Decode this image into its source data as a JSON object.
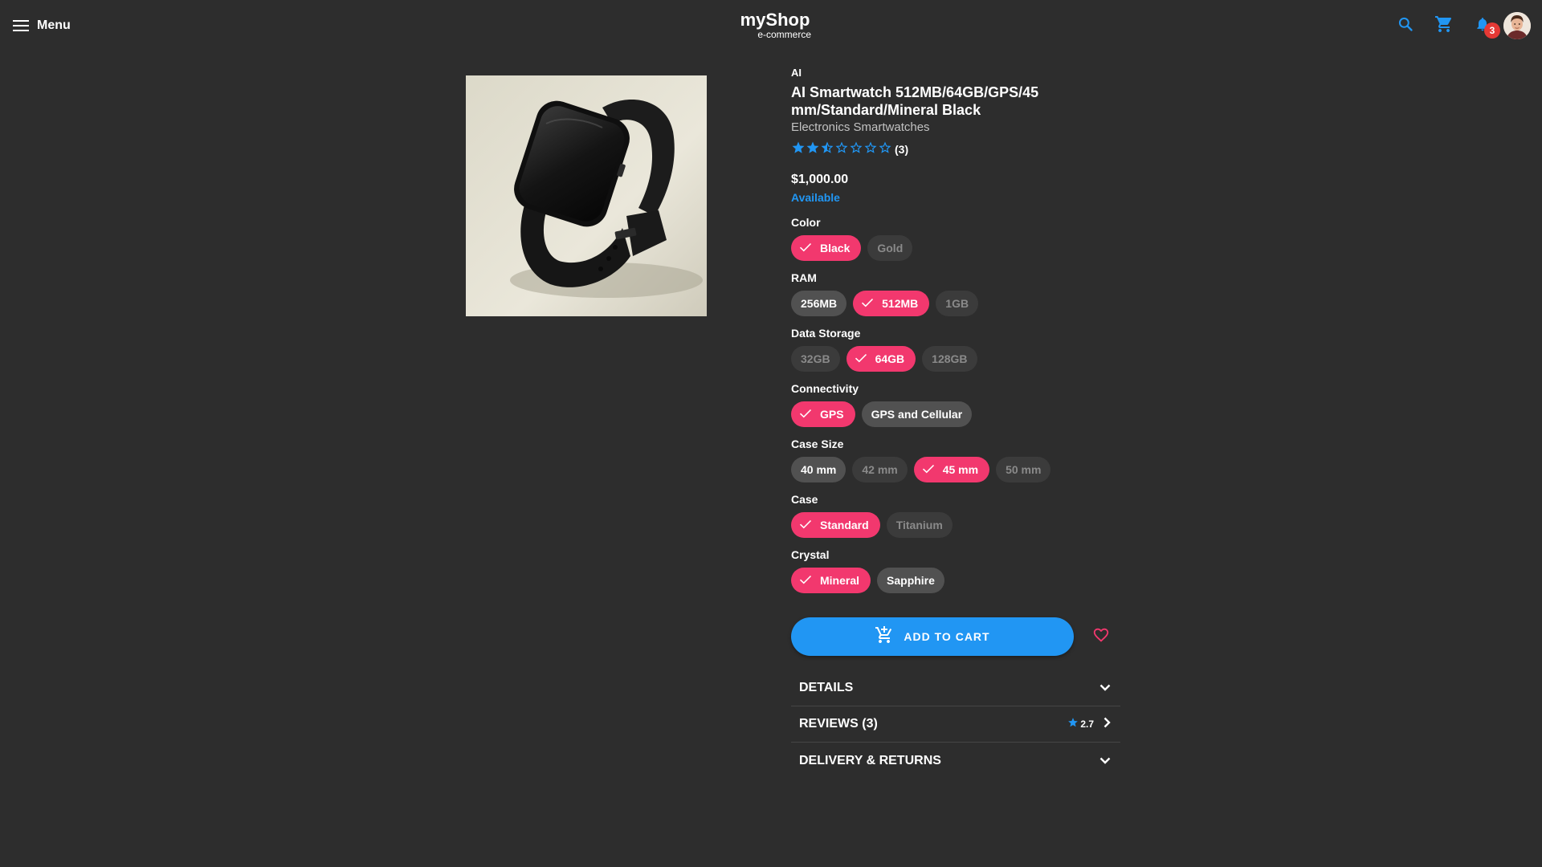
{
  "header": {
    "menu_label": "Menu",
    "brand_title": "myShop",
    "brand_subtitle": "e-commerce",
    "notification_count": "3",
    "icons": [
      "menu-icon",
      "search-icon",
      "cart-icon",
      "bell-icon",
      "avatar"
    ]
  },
  "product": {
    "brand": "AI",
    "title": "AI Smartwatch 512MB/64GB/GPS/45 mm/Standard/Mineral Black",
    "category": "Electronics Smartwatches",
    "rating": {
      "stars_total": 7,
      "stars_filled": 2,
      "stars_half": 1,
      "count_label": "(3)"
    },
    "price": "$1,000.00",
    "availability": "Available"
  },
  "options": [
    {
      "label": "Color",
      "choices": [
        {
          "label": "Black",
          "state": "selected"
        },
        {
          "label": "Gold",
          "state": "unavailable"
        }
      ]
    },
    {
      "label": "RAM",
      "choices": [
        {
          "label": "256MB",
          "state": "available"
        },
        {
          "label": "512MB",
          "state": "selected"
        },
        {
          "label": "1GB",
          "state": "unavailable"
        }
      ]
    },
    {
      "label": "Data Storage",
      "choices": [
        {
          "label": "32GB",
          "state": "unavailable"
        },
        {
          "label": "64GB",
          "state": "selected"
        },
        {
          "label": "128GB",
          "state": "unavailable"
        }
      ]
    },
    {
      "label": "Connectivity",
      "choices": [
        {
          "label": "GPS",
          "state": "selected"
        },
        {
          "label": "GPS and Cellular",
          "state": "available"
        }
      ]
    },
    {
      "label": "Case Size",
      "choices": [
        {
          "label": "40 mm",
          "state": "available"
        },
        {
          "label": "42 mm",
          "state": "unavailable"
        },
        {
          "label": "45 mm",
          "state": "selected"
        },
        {
          "label": "50 mm",
          "state": "unavailable"
        }
      ]
    },
    {
      "label": "Case",
      "choices": [
        {
          "label": "Standard",
          "state": "selected"
        },
        {
          "label": "Titanium",
          "state": "unavailable"
        }
      ]
    },
    {
      "label": "Crystal",
      "choices": [
        {
          "label": "Mineral",
          "state": "selected"
        },
        {
          "label": "Sapphire",
          "state": "available"
        }
      ]
    }
  ],
  "cart": {
    "add_to_cart_label": "ADD TO CART",
    "favorite_icon": "heart-outline-icon"
  },
  "sections": {
    "details": {
      "title": "DETAILS",
      "icon": "chevron-down-icon"
    },
    "reviews": {
      "title": "REVIEWS (3)",
      "rating": "2.7",
      "icon": "chevron-right-icon"
    },
    "delivery": {
      "title": "DELIVERY & RETURNS",
      "icon": "chevron-down-icon"
    }
  },
  "colors": {
    "background": "#2d2d2d",
    "accent_blue": "#2196f3",
    "selected_pink": "#f2386e",
    "badge_red": "#e53935"
  }
}
